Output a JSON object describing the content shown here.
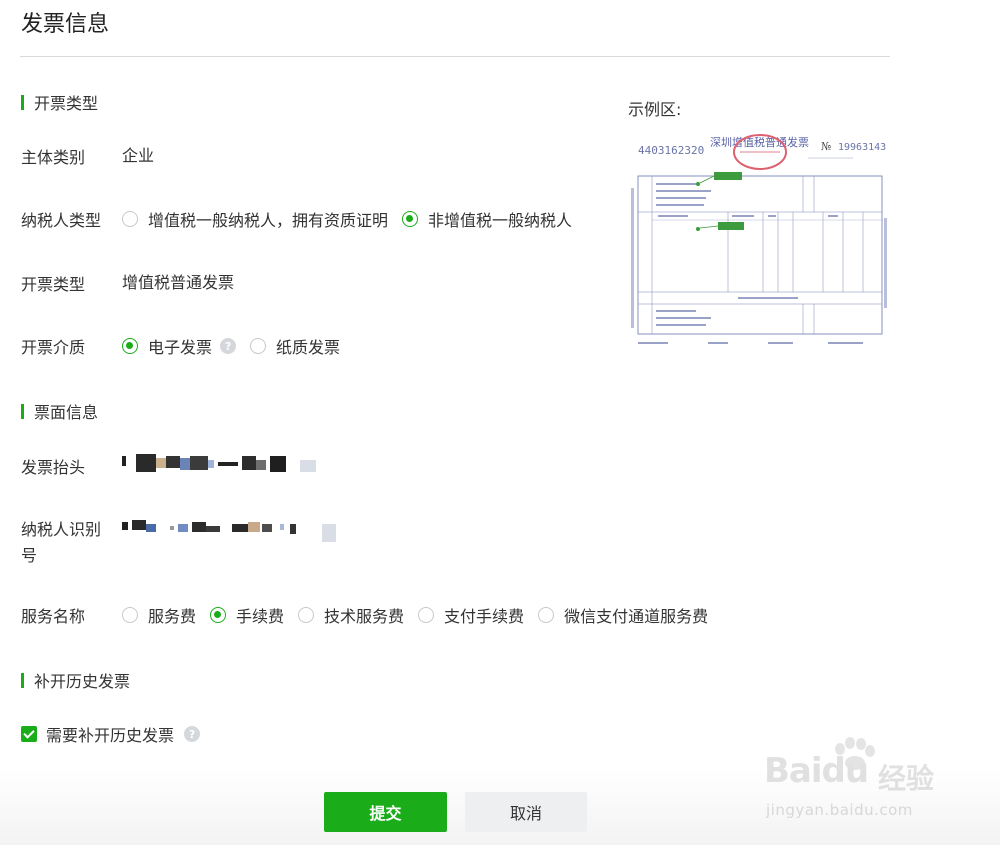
{
  "page": {
    "title": "发票信息"
  },
  "sections": {
    "invoice_type": "开票类型",
    "invoice_face": "票面信息",
    "history": "补开历史发票"
  },
  "fields": {
    "subject_category": {
      "label": "主体类别",
      "value": "企业"
    },
    "taxpayer_type": {
      "label": "纳税人类型",
      "options": [
        "增值税一般纳税人，拥有资质证明",
        "非增值税一般纳税人"
      ],
      "selected": "非增值税一般纳税人"
    },
    "invoice_kind": {
      "label": "开票类型",
      "value": "增值税普通发票"
    },
    "invoice_medium": {
      "label": "开票介质",
      "options": [
        "电子发票",
        "纸质发票"
      ],
      "selected": "电子发票"
    },
    "invoice_header": {
      "label": "发票抬头"
    },
    "taxpayer_id": {
      "label_line1": "纳税人识别",
      "label_line2": "号"
    },
    "service_name": {
      "label": "服务名称",
      "options": [
        "服务费",
        "手续费",
        "技术服务费",
        "支付手续费",
        "微信支付通道服务费"
      ],
      "selected": "手续费"
    }
  },
  "history_checkbox": {
    "label": "需要补开历史发票",
    "checked": true
  },
  "example": {
    "label": "示例区:",
    "invoice_number_left": "4403162320",
    "invoice_title": "深圳增值税普通发票",
    "invoice_no_mark": "№",
    "invoice_number_right": "19963143"
  },
  "buttons": {
    "submit": "提交",
    "cancel": "取消"
  },
  "watermark": {
    "brand": "Bai",
    "brand_tail": "du",
    "cn": "经验",
    "url": "jingyan.baidu.com"
  },
  "colors": {
    "accent": "#1aad19",
    "help_icon": "#d4d7dc"
  }
}
